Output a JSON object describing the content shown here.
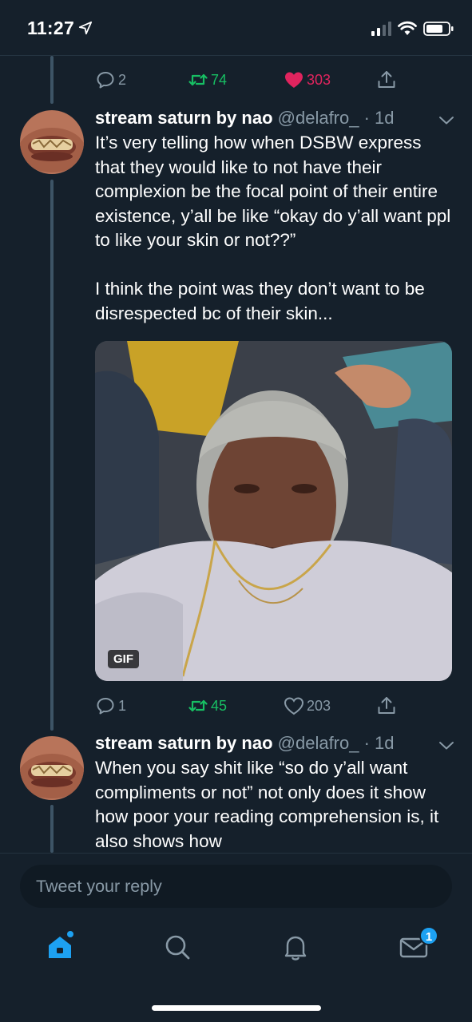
{
  "status_bar": {
    "time": "11:27"
  },
  "top_actions": {
    "replies": "2",
    "retweets": "74",
    "likes": "303"
  },
  "tweets": [
    {
      "name": "stream saturn by nao",
      "handle": "@delafro_",
      "time": "· 1d",
      "text": "It’s very telling how when DSBW express that they would like to not have their complexion be the focal point of their entire existence, y’all be like “okay do y’all want ppl to like your skin or not??”\n\nI think the point was they don’t want to be disrespected bc of their skin...",
      "media_badge": "GIF",
      "replies": "1",
      "retweets": "45",
      "likes": "203"
    },
    {
      "name": "stream saturn by nao",
      "handle": "@delafro_",
      "time": "· 1d",
      "text": "When you say shit like “so do y’all want compliments or not” not only does it show how poor your reading comprehension is, it also shows how"
    }
  ],
  "reply_box": {
    "placeholder": "Tweet your reply"
  },
  "tab_bar": {
    "messages_badge": "1"
  },
  "colors": {
    "background": "#15202b",
    "accent": "#1da1f2",
    "retweet": "#17bf63",
    "like": "#e0245e",
    "muted": "#8899a6"
  }
}
